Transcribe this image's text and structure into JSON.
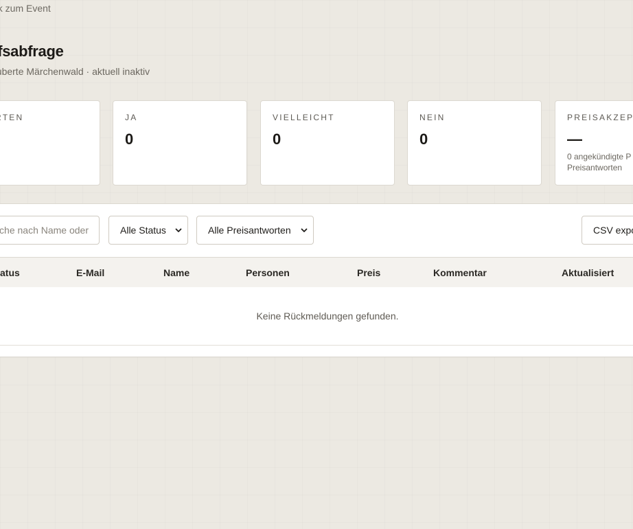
{
  "navigation": {
    "back_label": "ück zum Event"
  },
  "header": {
    "title": "arfsabfrage",
    "subtitle": "zauberte Märchenwald · aktuell inaktiv"
  },
  "stats": [
    {
      "label": "WORTEN",
      "value": ""
    },
    {
      "label": "JA",
      "value": "0"
    },
    {
      "label": "VIELLEICHT",
      "value": "0"
    },
    {
      "label": "NEIN",
      "value": "0"
    },
    {
      "label": "PREISAKZEPT",
      "value": "—",
      "note_line1": "0 angekündigte P",
      "note_line2": "Preisantworten"
    }
  ],
  "filters": {
    "search_placeholder": "che nach Name oder",
    "status_select": "Alle Status",
    "price_select": "Alle Preisantworten",
    "export_label": "CSV expo"
  },
  "table": {
    "columns": [
      "atus",
      "E-Mail",
      "Name",
      "Personen",
      "Preis",
      "Kommentar",
      "Aktualisiert"
    ],
    "empty_message": "Keine Rückmeldungen gefunden."
  }
}
